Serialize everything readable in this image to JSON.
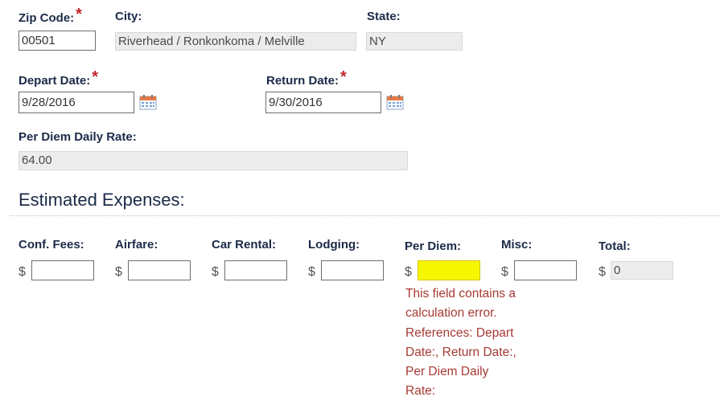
{
  "location": {
    "zip_label": "Zip Code:",
    "zip_value": "00501",
    "city_label": "City:",
    "city_value": "Riverhead / Ronkonkoma / Melville",
    "state_label": "State:",
    "state_value": "NY"
  },
  "dates": {
    "depart_label": "Depart Date:",
    "depart_value": "9/28/2016",
    "return_label": "Return Date:",
    "return_value": "9/30/2016"
  },
  "required_marker": "*",
  "per_diem_rate": {
    "label": "Per Diem Daily Rate:",
    "value": "64.00"
  },
  "expenses": {
    "heading": "Estimated Expenses:",
    "currency_symbol": "$",
    "conf_fees_label": "Conf. Fees:",
    "conf_fees_value": "",
    "airfare_label": "Airfare:",
    "airfare_value": "",
    "car_rental_label": "Car Rental:",
    "car_rental_value": "",
    "lodging_label": "Lodging:",
    "lodging_value": "",
    "per_diem_label": "Per Diem:",
    "per_diem_value": "",
    "misc_label": "Misc:",
    "misc_value": "",
    "total_label": "Total:",
    "total_value": "0"
  },
  "error": {
    "lines": [
      "This field contains a",
      "calculation error.",
      "References: Depart",
      "Date:, Return Date:,",
      "Per Diem Daily",
      "Rate:"
    ]
  },
  "colors": {
    "label_text": "#1b2a48",
    "required_star": "#c0272d",
    "error_text": "#a63a34",
    "error_highlight": "#f6f600",
    "readonly_bg": "#ececec"
  }
}
